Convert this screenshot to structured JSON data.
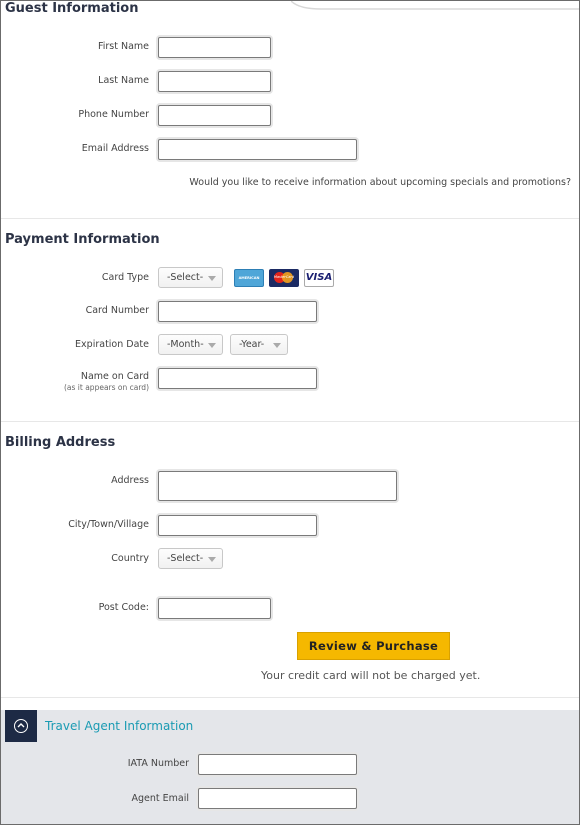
{
  "guest": {
    "title": "Guest Information",
    "first_name_label": "First Name",
    "last_name_label": "Last Name",
    "phone_label": "Phone Number",
    "email_label": "Email Address",
    "specials_question": "Would you like to receive information about upcoming specials and promotions?"
  },
  "payment": {
    "title": "Payment Information",
    "card_type_label": "Card Type",
    "card_type_value": "-Select-",
    "card_icons": [
      "amex-card-icon",
      "mastercard-card-icon",
      "visa-card-icon"
    ],
    "visa_text": "VISA",
    "mastercard_text": "MasterCard",
    "amex_text": "AMERICAN EXPRESS",
    "card_number_label": "Card Number",
    "expiration_label": "Expiration Date",
    "month_value": "-Month-",
    "year_value": "-Year-",
    "name_on_card_label": "Name on Card",
    "name_on_card_sublabel": "(as it appears on card)"
  },
  "billing": {
    "title": "Billing Address",
    "address_label": "Address",
    "city_label": "City/Town/Village",
    "country_label": "Country",
    "country_value": "-Select-",
    "postcode_label": "Post Code:"
  },
  "actions": {
    "review_button": "Review & Purchase",
    "charge_note": "Your credit card will not be charged yet."
  },
  "agent": {
    "title": "Travel Agent Information",
    "iata_label": "IATA Number",
    "email_label": "Agent Email"
  },
  "colors": {
    "button": "#f5b800",
    "heading": "#2c3346",
    "agent_link": "#1a9bb3",
    "agent_toggle": "#1d2a45"
  }
}
